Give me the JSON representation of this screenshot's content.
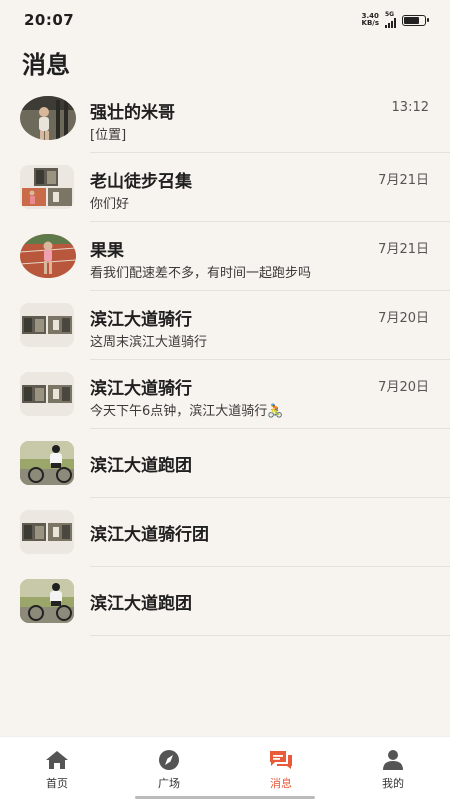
{
  "status_bar": {
    "time": "20:07",
    "speed_value": "3.40",
    "speed_unit": "KB/s",
    "network": "5G"
  },
  "page": {
    "title": "消息"
  },
  "messages": [
    {
      "name": "强壮的米哥",
      "preview": "[位置]",
      "time": "13:12",
      "avatar_icon": "runner-photo-avatar"
    },
    {
      "name": "老山徒步召集",
      "preview": "你们好",
      "time": "7月21日",
      "avatar_icon": "group-collage-avatar"
    },
    {
      "name": "果果",
      "preview": "看我们配速差不多，有时间一起跑步吗",
      "time": "7月21日",
      "avatar_icon": "track-runner-avatar"
    },
    {
      "name": "滨江大道骑行",
      "preview": "这周末滨江大道骑行",
      "time": "7月20日",
      "avatar_icon": "group-collage-avatar"
    },
    {
      "name": "滨江大道骑行",
      "preview": "今天下午6点钟，滨江大道骑行🚴",
      "time": "7月20日",
      "avatar_icon": "group-collage-avatar"
    },
    {
      "name": "滨江大道跑团",
      "preview": "",
      "time": "",
      "avatar_icon": "cyclist-photo-avatar"
    },
    {
      "name": "滨江大道骑行团",
      "preview": "",
      "time": "",
      "avatar_icon": "group-collage-avatar"
    },
    {
      "name": "滨江大道跑团",
      "preview": "",
      "time": "",
      "avatar_icon": "cyclist-photo-avatar"
    }
  ],
  "nav": {
    "home": "首页",
    "square": "广场",
    "messages": "消息",
    "mine": "我的",
    "active_color": "#e85a3a",
    "inactive_color": "#555555"
  }
}
